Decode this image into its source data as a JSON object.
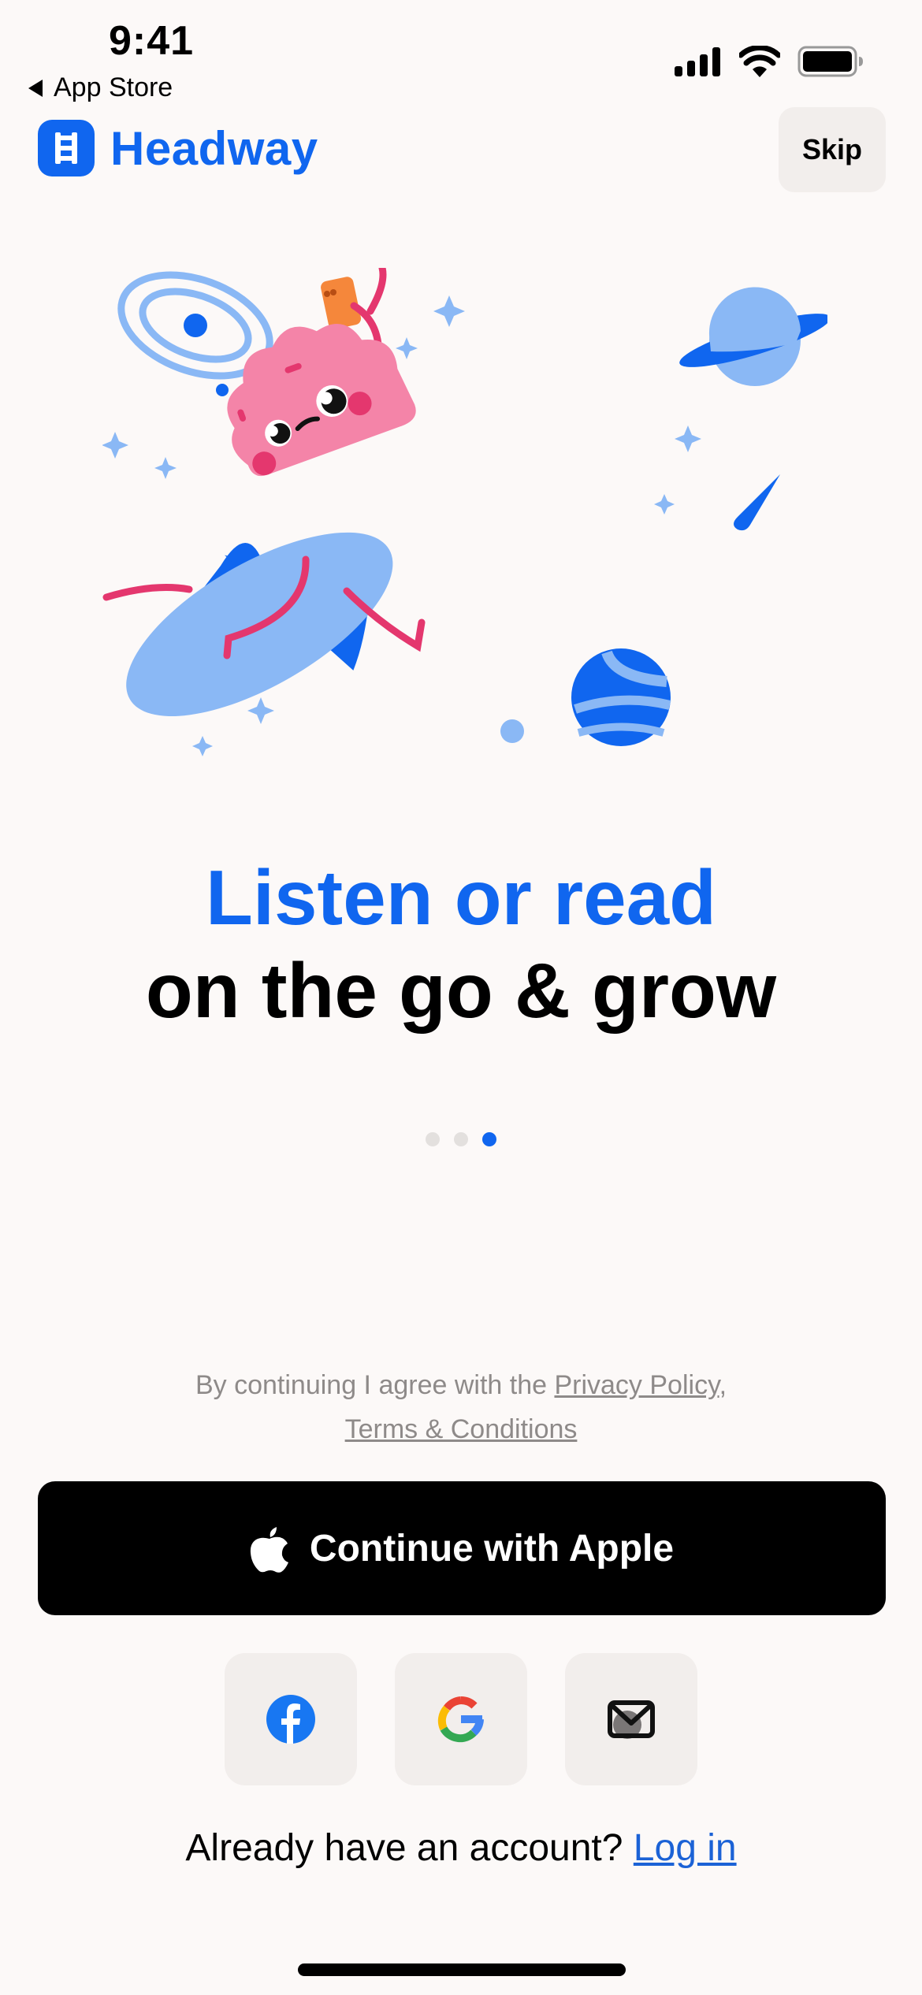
{
  "status_bar": {
    "time": "9:41",
    "back_label": "App Store",
    "icons": [
      "cellular-signal-icon",
      "wifi-icon",
      "battery-icon"
    ]
  },
  "header": {
    "brand_name": "Headway",
    "brand_icon": "ladder-book-icon",
    "skip_label": "Skip"
  },
  "colors": {
    "brand_blue": "#1066ef",
    "light_blue": "#8ab8f5",
    "pink": "#f484a8",
    "magenta": "#e4376e",
    "orange": "#f5873b",
    "background": "#fcf9f8",
    "button_gray": "#f2eeec"
  },
  "onboarding": {
    "title_line1": "Listen or read",
    "title_line2": "on the go & grow",
    "pager": {
      "total": 3,
      "active_index": 2
    }
  },
  "legal": {
    "prefix": "By continuing I agree with the ",
    "privacy_link": "Privacy Policy",
    "separator": ",",
    "terms_link": "Terms & Conditions"
  },
  "auth": {
    "apple_label": "Continue with Apple",
    "social_buttons": [
      {
        "name": "facebook",
        "icon": "facebook-icon"
      },
      {
        "name": "google",
        "icon": "google-icon"
      },
      {
        "name": "email",
        "icon": "mail-icon"
      }
    ],
    "login_prompt": "Already have an account? ",
    "login_link": "Log in"
  }
}
